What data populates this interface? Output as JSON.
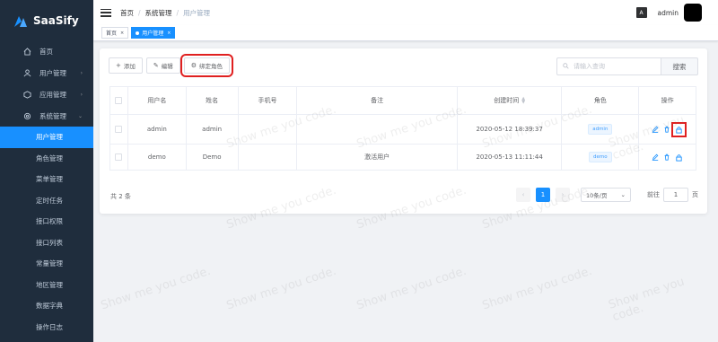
{
  "brand": {
    "name": "SaaSify",
    "accent": "#1890ff",
    "sidebar_bg": "#1f2d3d"
  },
  "sidebar": {
    "items": [
      {
        "label": "首页",
        "icon": "home-icon"
      },
      {
        "label": "用户管理",
        "icon": "user-icon",
        "arrow": "›"
      },
      {
        "label": "应用管理",
        "icon": "app-icon",
        "arrow": "›"
      },
      {
        "label": "系统管理",
        "icon": "gear-icon",
        "arrow": "⌄"
      }
    ],
    "sub_items": [
      "用户管理",
      "角色管理",
      "菜单管理",
      "定时任务",
      "接口权限",
      "接口列表",
      "常量管理",
      "地区管理",
      "数据字典",
      "操作日志"
    ]
  },
  "header": {
    "breadcrumb": [
      "首页",
      "系统管理",
      "用户管理"
    ],
    "separator": "/",
    "lang_icon": "A",
    "username": "admin"
  },
  "tags": [
    {
      "label": "首页",
      "close": "×"
    },
    {
      "label": "用户管理",
      "close": "×"
    }
  ],
  "toolbar": {
    "add": {
      "icon": "+",
      "label": "添加"
    },
    "edit": {
      "icon": "✎",
      "label": "编辑"
    },
    "bind": {
      "icon": "⚙",
      "label": "绑定角色"
    }
  },
  "search": {
    "placeholder": "请输入查询",
    "button": "搜索"
  },
  "table": {
    "headers": [
      "用户名",
      "姓名",
      "手机号",
      "备注",
      "创建时间",
      "角色",
      "操作"
    ],
    "rows": [
      {
        "username": "admin",
        "name": "admin",
        "phone": "",
        "remark": "",
        "created": "2020-05-12 18:39:37",
        "role": "admin"
      },
      {
        "username": "demo",
        "name": "Demo",
        "phone": "",
        "remark": "激活用户",
        "created": "2020-05-13 11:11:44",
        "role": "demo"
      }
    ]
  },
  "pagination": {
    "total": "共 2 条",
    "prev": "‹",
    "next": "›",
    "current": "1",
    "page_size": "10条/页",
    "goto_label": "前往",
    "goto_value": "1",
    "page_suffix": "页"
  },
  "watermark": "Show me you code."
}
